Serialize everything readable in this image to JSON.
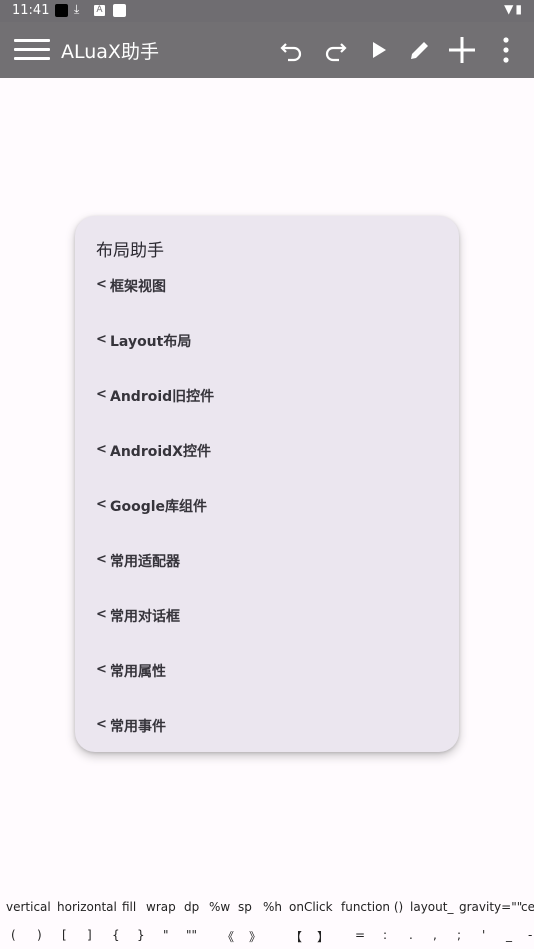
{
  "status_bar": {
    "time": "11:41"
  },
  "app_bar": {
    "title": "ALuaX助手",
    "actions": [
      {
        "name": "undo-icon"
      },
      {
        "name": "redo-icon"
      },
      {
        "name": "run-icon"
      },
      {
        "name": "edit-icon"
      },
      {
        "name": "add-icon"
      },
      {
        "name": "more-icon"
      }
    ]
  },
  "menu": {
    "title": "布局助手",
    "chevron": "<",
    "items": [
      {
        "label": "框架视图"
      },
      {
        "label": "Layout布局"
      },
      {
        "label": "Android旧控件"
      },
      {
        "label": "AndroidX控件"
      },
      {
        "label": "Google库组件"
      },
      {
        "label": "常用适配器"
      },
      {
        "label": "常用对话框"
      },
      {
        "label": "常用属性"
      },
      {
        "label": "常用事件"
      }
    ]
  },
  "keyboard_bar": {
    "row1": [
      "vertical",
      "horizontal",
      "fill",
      "wrap",
      "dp",
      "%w",
      "sp",
      "%h",
      "onClick",
      "function ()",
      "layout_",
      "gravity=\"\"",
      "ce"
    ],
    "row2": [
      "(",
      ")",
      "[",
      "]",
      "{",
      "}",
      "\"",
      "\"\"",
      "《",
      "》",
      "【",
      "】",
      "=",
      ":",
      ".",
      ",",
      ";",
      "'",
      "_",
      "-"
    ]
  }
}
